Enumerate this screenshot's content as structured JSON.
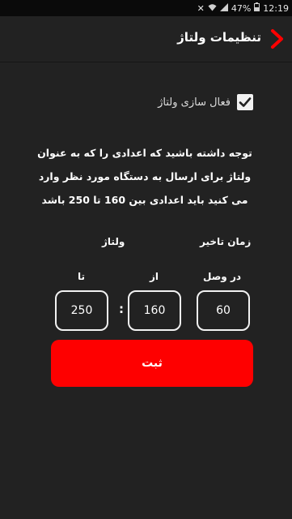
{
  "status_bar": {
    "battery": "47%",
    "time": "12:19"
  },
  "header": {
    "title": "تنظیمات ولتاژ"
  },
  "enable_voltage": {
    "label": "فعال سازی ولتاژ",
    "checked": true
  },
  "note": "توجه داشته باشید که اعدادی را که به عنوان ولتاژ برای ارسال به دستگاه مورد نظر وارد می کنید باید اعدادی بین 160 تا 250 باشد",
  "headers": {
    "delay_time": "زمان تاخیر",
    "voltage": "ولتاژ",
    "on_connect": "در وصل",
    "from": "از",
    "to": "تا"
  },
  "fields": {
    "delay_value": "60",
    "voltage_from": "160",
    "voltage_to": "250"
  },
  "separator": ":",
  "submit_label": "ثبت",
  "colors": {
    "accent": "#fe0000",
    "background": "#222222"
  }
}
